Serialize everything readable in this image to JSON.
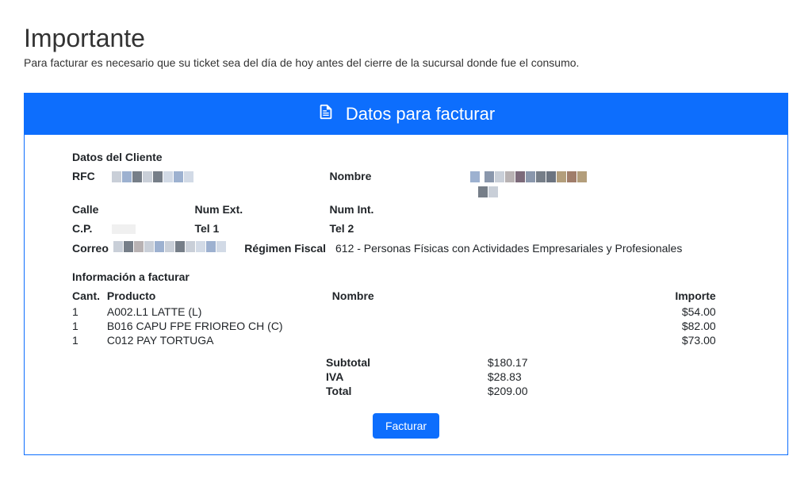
{
  "page": {
    "title": "Importante",
    "subtitle": "Para facturar es necesario que su ticket sea del día de hoy antes del cierre de la sucursal donde fue el consumo."
  },
  "panel": {
    "header": "Datos para facturar"
  },
  "client": {
    "section_title": "Datos del Cliente",
    "labels": {
      "rfc": "RFC",
      "nombre": "Nombre",
      "calle": "Calle",
      "num_ext": "Num Ext.",
      "num_int": "Num Int.",
      "cp": "C.P.",
      "tel1": "Tel 1",
      "tel2": "Tel 2",
      "correo": "Correo",
      "regimen_fiscal": "Régimen Fiscal"
    },
    "regimen_value": "612 - Personas Físicas con Actividades Empresariales y Profesionales"
  },
  "invoice": {
    "section_title": "Información a facturar",
    "headers": {
      "cant": "Cant.",
      "producto": "Producto",
      "nombre": "Nombre",
      "importe": "Importe"
    },
    "lines": [
      {
        "cant": "1",
        "producto": "A002.L1 LATTE (L)",
        "importe": "$54.00"
      },
      {
        "cant": "1",
        "producto": "B016 CAPU FPE FRIOREO CH (C)",
        "importe": "$82.00"
      },
      {
        "cant": "1",
        "producto": "C012 PAY TORTUGA",
        "importe": "$73.00"
      }
    ],
    "totals": {
      "subtotal_label": "Subtotal",
      "subtotal_value": "$180.17",
      "iva_label": "IVA",
      "iva_value": "$28.83",
      "total_label": "Total",
      "total_value": "$209.00"
    }
  },
  "buttons": {
    "facturar": "Facturar"
  }
}
